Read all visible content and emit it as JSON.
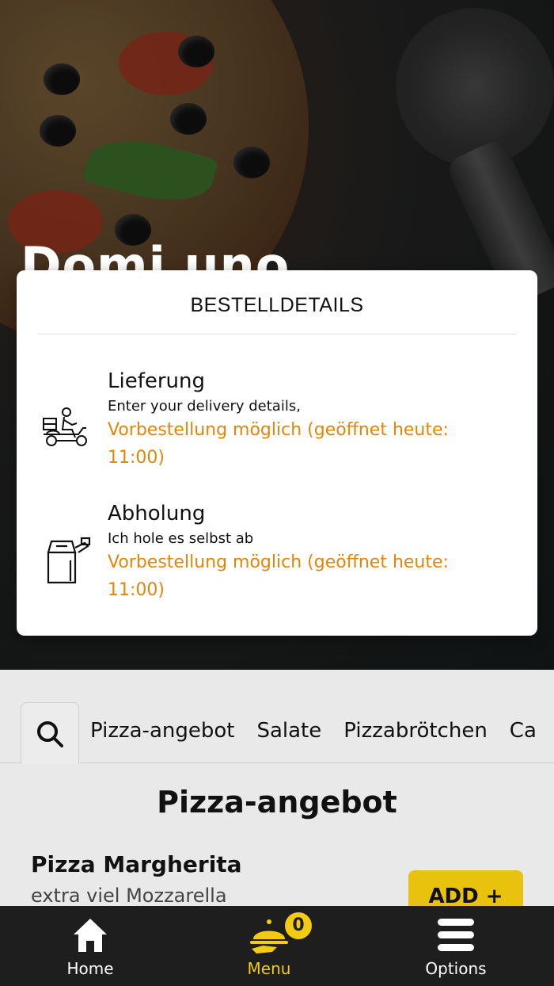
{
  "hero": {
    "restaurant_name": "Domi uno"
  },
  "modal": {
    "title": "BESTELLDETAILS",
    "options": [
      {
        "icon": "delivery-scooter-icon",
        "title": "Lieferung",
        "subtitle": "Enter your delivery details,",
        "note": "Vorbestellung möglich (geöffnet heute: 11:00)"
      },
      {
        "icon": "pickup-bag-icon",
        "title": "Abholung",
        "subtitle": "Ich hole es selbst ab",
        "note": "Vorbestellung möglich (geöffnet heute: 11:00)"
      }
    ]
  },
  "categories": [
    "Pizza-angebot",
    "Salate",
    "Pizzabrötchen",
    "Ca"
  ],
  "section": {
    "title": "Pizza-angebot"
  },
  "item": {
    "name": "Pizza Margherita",
    "description": "extra viel Mozzarella",
    "add_label": "ADD +"
  },
  "nav": {
    "items": [
      {
        "label": "Home",
        "icon": "home-icon"
      },
      {
        "label": "Menu",
        "icon": "cloche-icon",
        "badge": "0"
      },
      {
        "label": "Options",
        "icon": "menu-lines-icon"
      }
    ]
  },
  "colors": {
    "accent": "#f2cc12",
    "note": "#e0870b",
    "nav_bg": "#1e1e1e"
  }
}
